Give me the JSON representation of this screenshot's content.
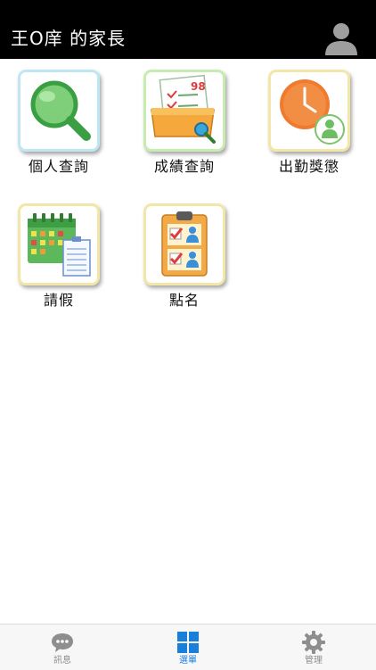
{
  "header": {
    "title": "王O庠 的家長"
  },
  "menu": {
    "items": [
      {
        "label": "個人查詢",
        "icon": "magnifier-icon"
      },
      {
        "label": "成績查詢",
        "icon": "score-report-icon"
      },
      {
        "label": "出勤獎懲",
        "icon": "attendance-clock-icon"
      },
      {
        "label": "請假",
        "icon": "calendar-leave-icon"
      },
      {
        "label": "點名",
        "icon": "roll-call-clipboard-icon"
      }
    ]
  },
  "score_badge": "98",
  "tabbar": {
    "tabs": [
      {
        "label": "訊息",
        "icon": "chat-bubble-icon",
        "active": false
      },
      {
        "label": "選單",
        "icon": "grid-menu-icon",
        "active": true
      },
      {
        "label": "管理",
        "icon": "gear-icon",
        "active": false
      }
    ]
  },
  "colors": {
    "active_tab": "#1a7fd9",
    "inactive_tab": "#8e8e8e",
    "header_bg": "#000000"
  }
}
